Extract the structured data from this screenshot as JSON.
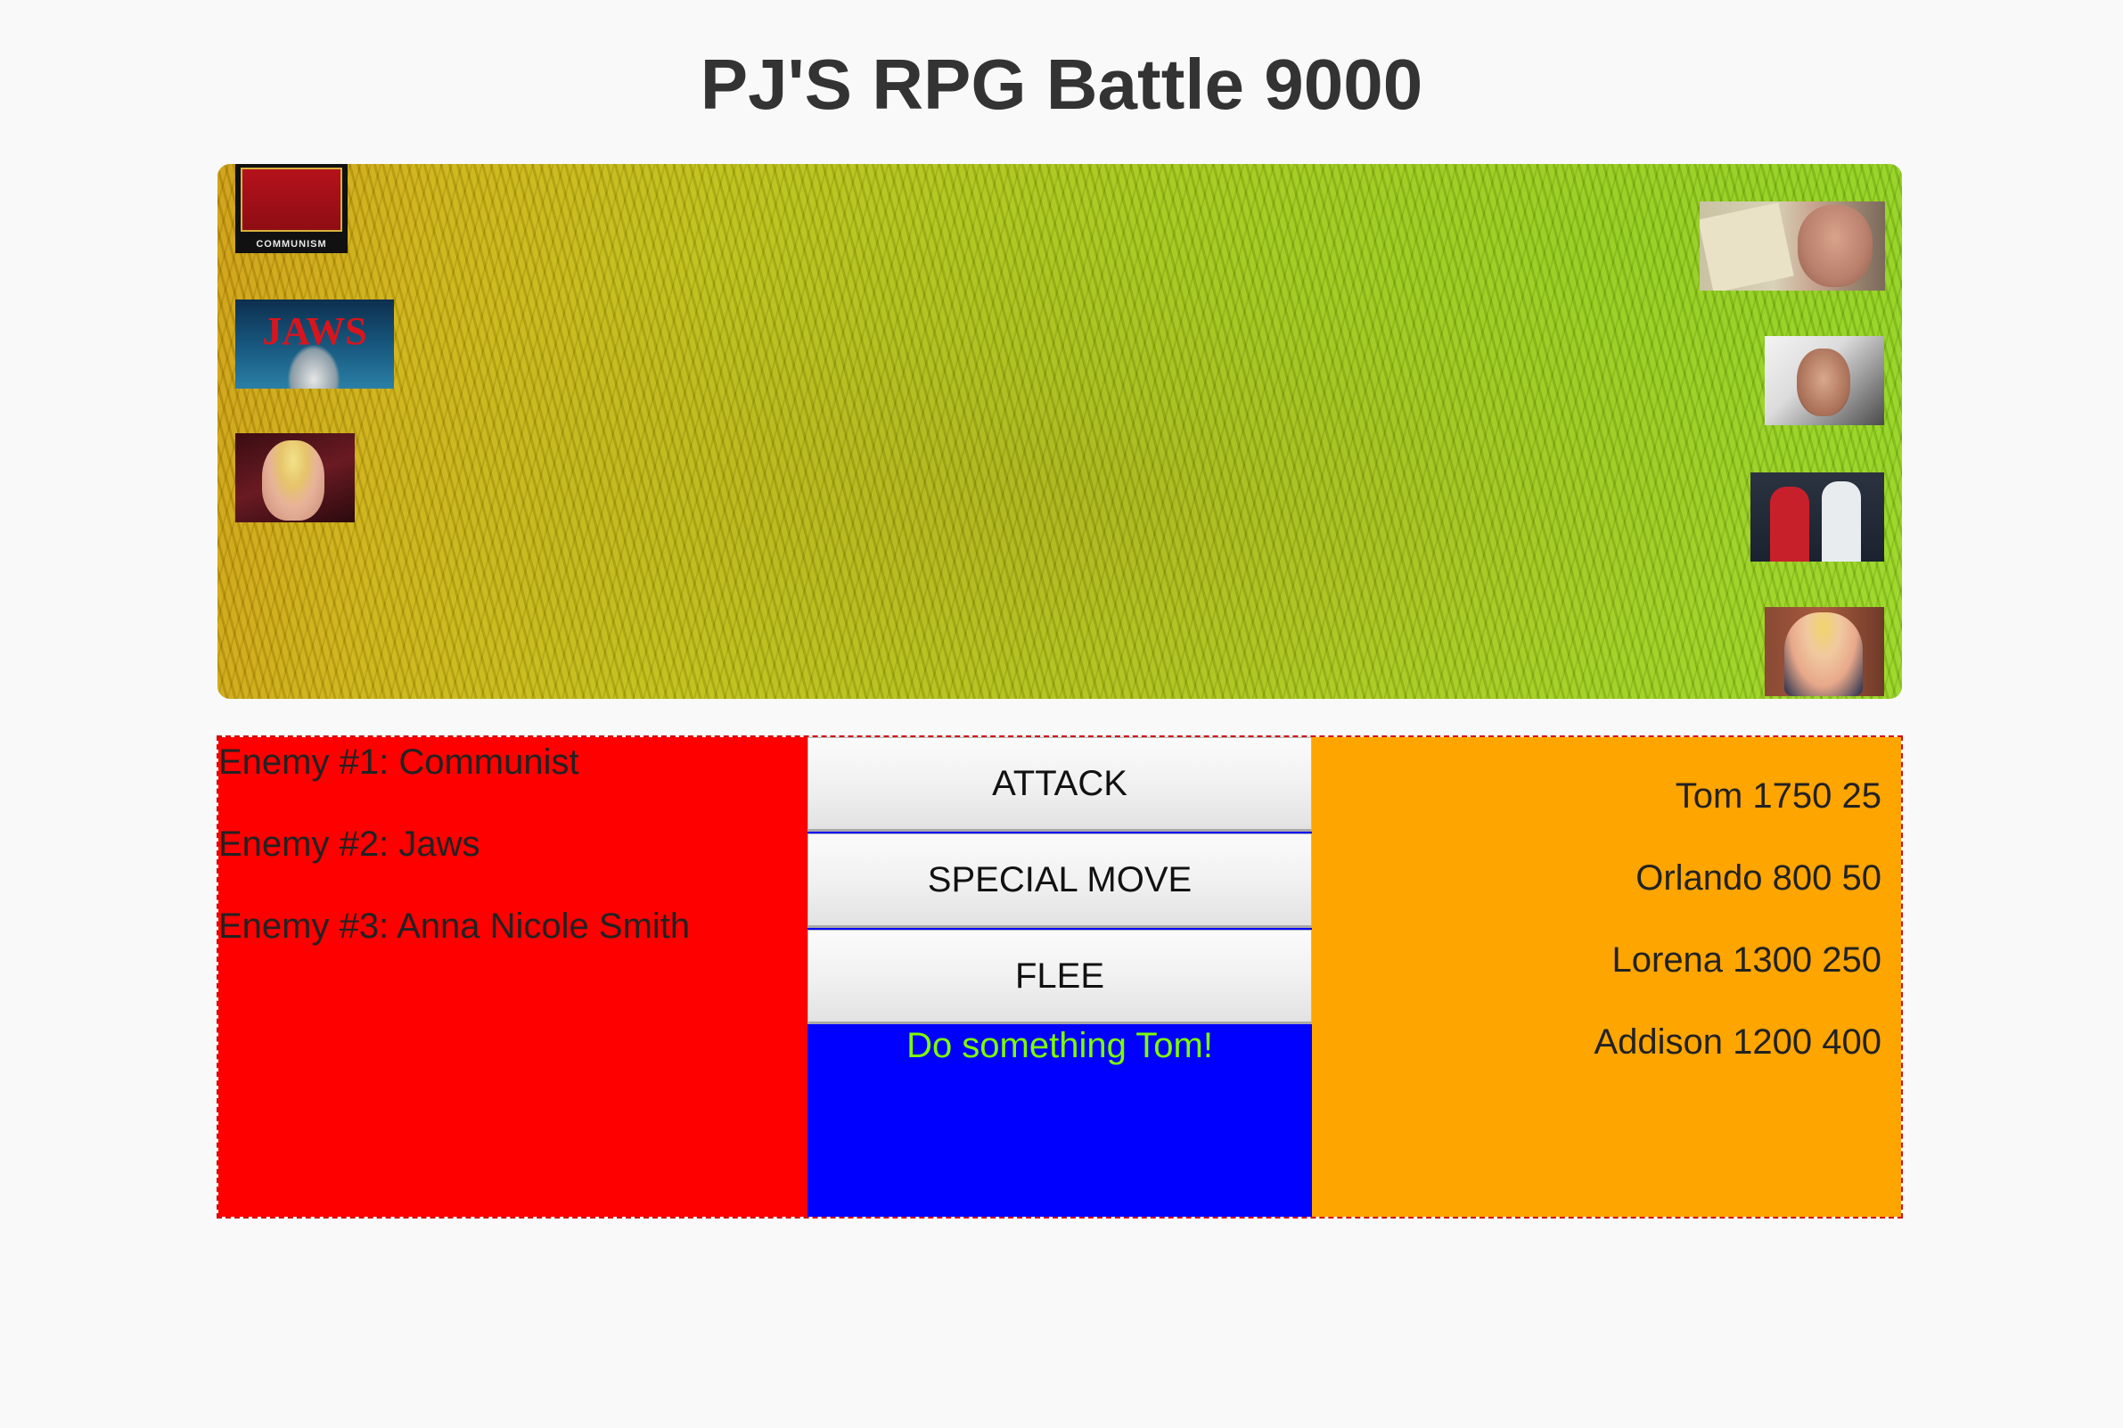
{
  "title": "PJ'S RPG Battle 9000",
  "battlefield": {
    "enemies": [
      {
        "name": "Communist",
        "sprite_text": "COMMUNISM"
      },
      {
        "name": "Jaws",
        "sprite_text": "JAWS"
      },
      {
        "name": "Anna Nicole Smith",
        "sprite_text": ""
      }
    ],
    "heroes": [
      {
        "name": "Tom"
      },
      {
        "name": "Orlando"
      },
      {
        "name": "Lorena"
      },
      {
        "name": "Addison"
      }
    ]
  },
  "enemy_list": [
    "Enemy #1: Communist",
    "Enemy #2: Jaws",
    "Enemy #3: Anna Nicole Smith"
  ],
  "actions": {
    "attack": "ATTACK",
    "special": "SPECIAL MOVE",
    "flee": "FLEE"
  },
  "status_message": "Do something Tom!",
  "hero_stats": [
    "Tom 1750 25",
    "Orlando 800 50",
    "Lorena 1300 250",
    "Addison 1200 400"
  ],
  "colors": {
    "enemy_panel": "#ff0000",
    "action_panel": "#0000ff",
    "hero_panel": "#ffa500",
    "status_text": "#7cfc00"
  }
}
